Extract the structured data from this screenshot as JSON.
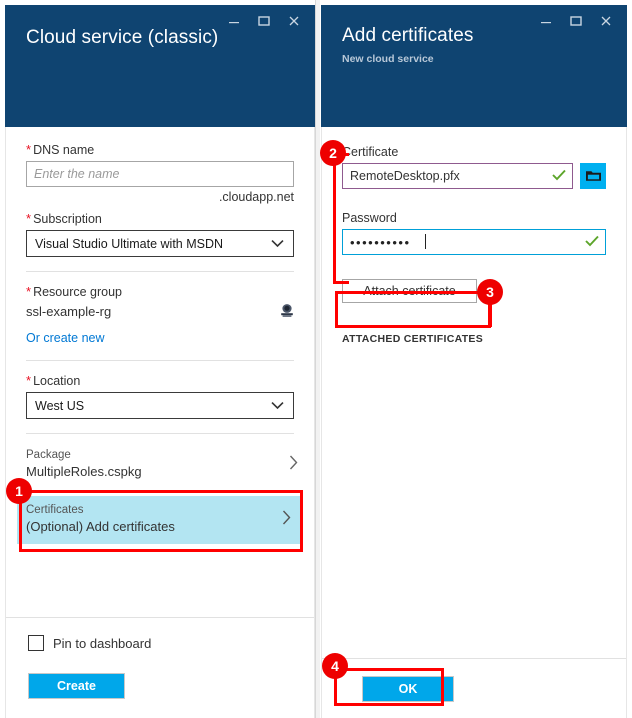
{
  "left_blade": {
    "title": "Cloud service (classic)",
    "window_controls": [
      {
        "name": "minimize",
        "glyph": "minimize-icon"
      },
      {
        "name": "maximize",
        "glyph": "maximize-icon"
      },
      {
        "name": "close",
        "glyph": "close-icon"
      }
    ],
    "dns": {
      "label": "DNS name",
      "required": true,
      "value": "",
      "placeholder": "Enter the name",
      "suffix": ".cloudapp.net"
    },
    "subscription": {
      "label": "Subscription",
      "required": true,
      "value": "Visual Studio Ultimate with MSDN"
    },
    "resource_group": {
      "label": "Resource group",
      "required": true,
      "value": "ssl-example-rg",
      "create_new_link": "Or create new"
    },
    "location": {
      "label": "Location",
      "required": true,
      "value": "West US"
    },
    "package": {
      "label": "Package",
      "value": "MultipleRoles.cspkg"
    },
    "certificates": {
      "label": "Certificates",
      "value": "(Optional) Add certificates",
      "selected": true
    },
    "pin_to_dashboard": {
      "label": "Pin to dashboard",
      "checked": false
    },
    "create_button": "Create"
  },
  "right_blade": {
    "title": "Add certificates",
    "subtitle": "New cloud service",
    "window_controls": [
      {
        "name": "minimize",
        "glyph": "minimize-icon"
      },
      {
        "name": "maximize",
        "glyph": "maximize-icon"
      },
      {
        "name": "close",
        "glyph": "close-icon"
      }
    ],
    "certificate": {
      "label": "Certificate",
      "value": "RemoteDesktop.pfx",
      "valid": true,
      "browse_icon": "folder-icon"
    },
    "password": {
      "label": "Password",
      "value": "••••••••••",
      "valid": true
    },
    "attach_button": "Attach certificate",
    "attached_section_header": "ATTACHED CERTIFICATES",
    "ok_button": "OK"
  },
  "annotations": {
    "badges": [
      {
        "number": "1",
        "target": "certificates-row"
      },
      {
        "number": "2",
        "target": "certificate-and-password-fields"
      },
      {
        "number": "3",
        "target": "attach-certificate-button"
      },
      {
        "number": "4",
        "target": "ok-button"
      }
    ],
    "color": "#ee0000"
  },
  "colors": {
    "header_blue": "#0f4471",
    "accent_cyan": "#00a7ea",
    "selected_row": "#b3e5f2",
    "required_star": "#e81123",
    "link": "#0078d4",
    "valid_check": "#5ca52a",
    "annotation_red": "#ee0000"
  }
}
